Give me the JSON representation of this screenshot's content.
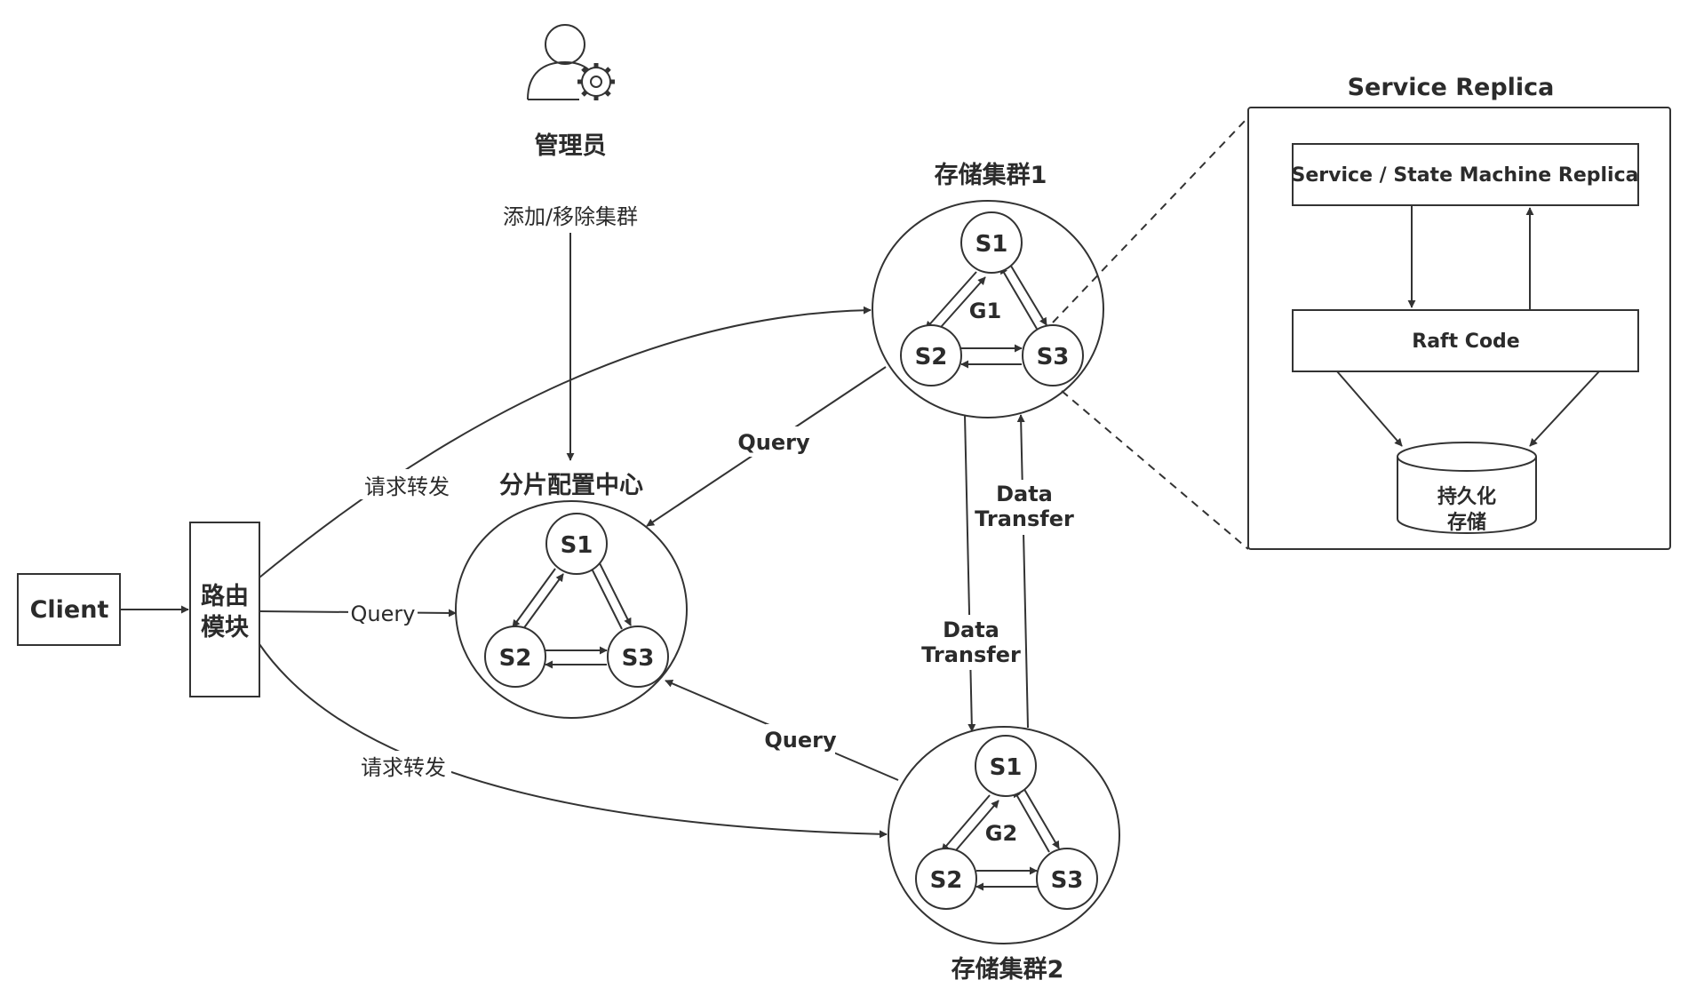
{
  "admin": {
    "label": "管理员",
    "action": "添加/移除集群"
  },
  "client": {
    "label": "Client"
  },
  "router": {
    "line1": "路由",
    "line2": "模块"
  },
  "config_center": {
    "title": "分片配置中心",
    "s1": "S1",
    "s2": "S2",
    "s3": "S3"
  },
  "cluster1": {
    "title": "存储集群1",
    "group": "G1",
    "s1": "S1",
    "s2": "S2",
    "s3": "S3"
  },
  "cluster2": {
    "title": "存储集群2",
    "group": "G2",
    "s1": "S1",
    "s2": "S2",
    "s3": "S3"
  },
  "edges": {
    "forward_top": "请求转发",
    "forward_bottom": "请求转发",
    "query_router": "Query",
    "query_cluster1": "Query",
    "query_cluster2": "Query",
    "transfer_down_l1": "Data",
    "transfer_down_l2": "Transfer",
    "transfer_up_l1": "Data",
    "transfer_up_l2": "Transfer"
  },
  "replica": {
    "title": "Service Replica",
    "service_box": "Service / State Machine Replica",
    "raft_box": "Raft Code",
    "storage_l1": "持久化",
    "storage_l2": "存储"
  },
  "colors": {
    "stroke": "#333333",
    "text": "#2b2b2b",
    "background": "#ffffff"
  }
}
